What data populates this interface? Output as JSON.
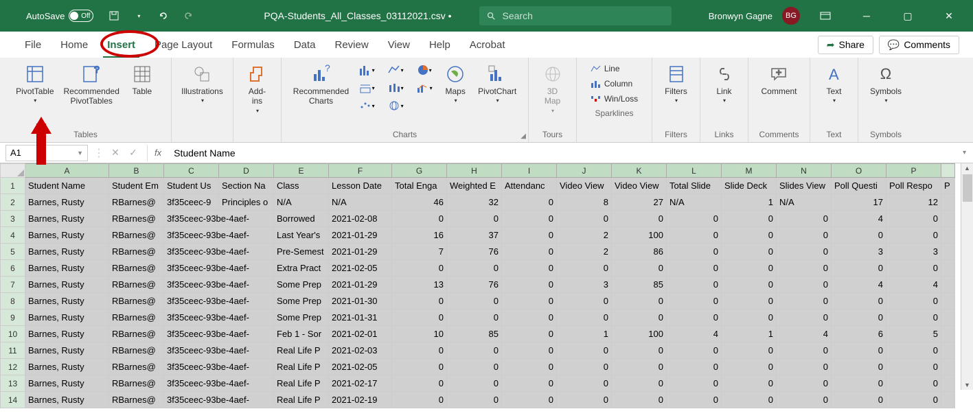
{
  "titlebar": {
    "autosave_label": "AutoSave",
    "autosave_state": "Off",
    "filename": "PQA-Students_All_Classes_03112021.csv  •",
    "search_placeholder": "Search",
    "username": "Bronwyn Gagne",
    "user_initials": "BG"
  },
  "tabs": {
    "items": [
      "File",
      "Home",
      "Insert",
      "Page Layout",
      "Formulas",
      "Data",
      "Review",
      "View",
      "Help",
      "Acrobat"
    ],
    "active_index": 2,
    "share": "Share",
    "comments": "Comments"
  },
  "ribbon": {
    "groups": {
      "tables": {
        "label": "Tables",
        "pivottable": "PivotTable",
        "recommended_pt": "Recommended\nPivotTables",
        "table": "Table"
      },
      "illustrations": {
        "label": "Illustrations",
        "btn": "Illustrations"
      },
      "addins": {
        "label": "Add-ins",
        "btn": "Add-\nins"
      },
      "charts": {
        "label": "Charts",
        "recommended": "Recommended\nCharts",
        "maps": "Maps",
        "pivotchart": "PivotChart"
      },
      "tours": {
        "label": "Tours",
        "btn": "3D\nMap"
      },
      "sparklines": {
        "label": "Sparklines",
        "line": "Line",
        "column": "Column",
        "winloss": "Win/Loss"
      },
      "filters": {
        "label": "Filters",
        "btn": "Filters"
      },
      "links": {
        "label": "Links",
        "btn": "Link"
      },
      "comments": {
        "label": "Comments",
        "btn": "Comment"
      },
      "text": {
        "label": "Text",
        "btn": "Text"
      },
      "symbols": {
        "label": "Symbols",
        "btn": "Symbols"
      }
    }
  },
  "formula_bar": {
    "namebox": "A1",
    "formula": "Student Name"
  },
  "grid": {
    "columns": [
      "A",
      "B",
      "C",
      "D",
      "E",
      "F",
      "G",
      "H",
      "I",
      "J",
      "K",
      "L",
      "M",
      "N",
      "O",
      "P"
    ],
    "headers": [
      "Student Name",
      "Student Em",
      "Student Us",
      "Section Na",
      "Class",
      "Lesson Date",
      "Total Enga",
      "Weighted E",
      "Attendanc",
      "Video View",
      "Video View",
      "Total Slide",
      "Slide Deck",
      "Slides View",
      "Poll Questi",
      "Poll Respo"
    ],
    "rows": [
      [
        "Barnes, Rusty",
        "RBarnes@",
        "3f35ceec-9",
        "Principles o",
        "N/A",
        "N/A",
        "46",
        "32",
        "0",
        "8",
        "27",
        "N/A",
        "1",
        "N/A",
        "17",
        "12"
      ],
      [
        "Barnes, Rusty",
        "RBarnes@",
        "3f35ceec-93be-4aef-",
        "Borrowed",
        "2021-02-08",
        "0",
        "0",
        "0",
        "0",
        "0",
        "0",
        "0",
        "0",
        "4",
        "0"
      ],
      [
        "Barnes, Rusty",
        "RBarnes@",
        "3f35ceec-93be-4aef-",
        "Last Year's",
        "2021-01-29",
        "16",
        "37",
        "0",
        "2",
        "100",
        "0",
        "0",
        "0",
        "0",
        "0"
      ],
      [
        "Barnes, Rusty",
        "RBarnes@",
        "3f35ceec-93be-4aef-",
        "Pre-Semest",
        "2021-01-29",
        "7",
        "76",
        "0",
        "2",
        "86",
        "0",
        "0",
        "0",
        "3",
        "3"
      ],
      [
        "Barnes, Rusty",
        "RBarnes@",
        "3f35ceec-93be-4aef-",
        "Extra Pract",
        "2021-02-05",
        "0",
        "0",
        "0",
        "0",
        "0",
        "0",
        "0",
        "0",
        "0",
        "0"
      ],
      [
        "Barnes, Rusty",
        "RBarnes@",
        "3f35ceec-93be-4aef-",
        "Some Prep",
        "2021-01-29",
        "13",
        "76",
        "0",
        "3",
        "85",
        "0",
        "0",
        "0",
        "4",
        "4"
      ],
      [
        "Barnes, Rusty",
        "RBarnes@",
        "3f35ceec-93be-4aef-",
        "Some Prep",
        "2021-01-30",
        "0",
        "0",
        "0",
        "0",
        "0",
        "0",
        "0",
        "0",
        "0",
        "0"
      ],
      [
        "Barnes, Rusty",
        "RBarnes@",
        "3f35ceec-93be-4aef-",
        "Some Prep",
        "2021-01-31",
        "0",
        "0",
        "0",
        "0",
        "0",
        "0",
        "0",
        "0",
        "0",
        "0"
      ],
      [
        "Barnes, Rusty",
        "RBarnes@",
        "3f35ceec-93be-4aef-",
        "Feb 1 - Sor",
        "2021-02-01",
        "10",
        "85",
        "0",
        "1",
        "100",
        "4",
        "1",
        "4",
        "6",
        "5"
      ],
      [
        "Barnes, Rusty",
        "RBarnes@",
        "3f35ceec-93be-4aef-",
        "Real Life P",
        "2021-02-03",
        "0",
        "0",
        "0",
        "0",
        "0",
        "0",
        "0",
        "0",
        "0",
        "0"
      ],
      [
        "Barnes, Rusty",
        "RBarnes@",
        "3f35ceec-93be-4aef-",
        "Real Life P",
        "2021-02-05",
        "0",
        "0",
        "0",
        "0",
        "0",
        "0",
        "0",
        "0",
        "0",
        "0"
      ],
      [
        "Barnes, Rusty",
        "RBarnes@",
        "3f35ceec-93be-4aef-",
        "Real Life P",
        "2021-02-17",
        "0",
        "0",
        "0",
        "0",
        "0",
        "0",
        "0",
        "0",
        "0",
        "0"
      ],
      [
        "Barnes, Rusty",
        "RBarnes@",
        "3f35ceec-93be-4aef-",
        "Real Life P",
        "2021-02-19",
        "0",
        "0",
        "0",
        "0",
        "0",
        "0",
        "0",
        "0",
        "0",
        "0"
      ]
    ],
    "numeric_col_start": 6
  }
}
